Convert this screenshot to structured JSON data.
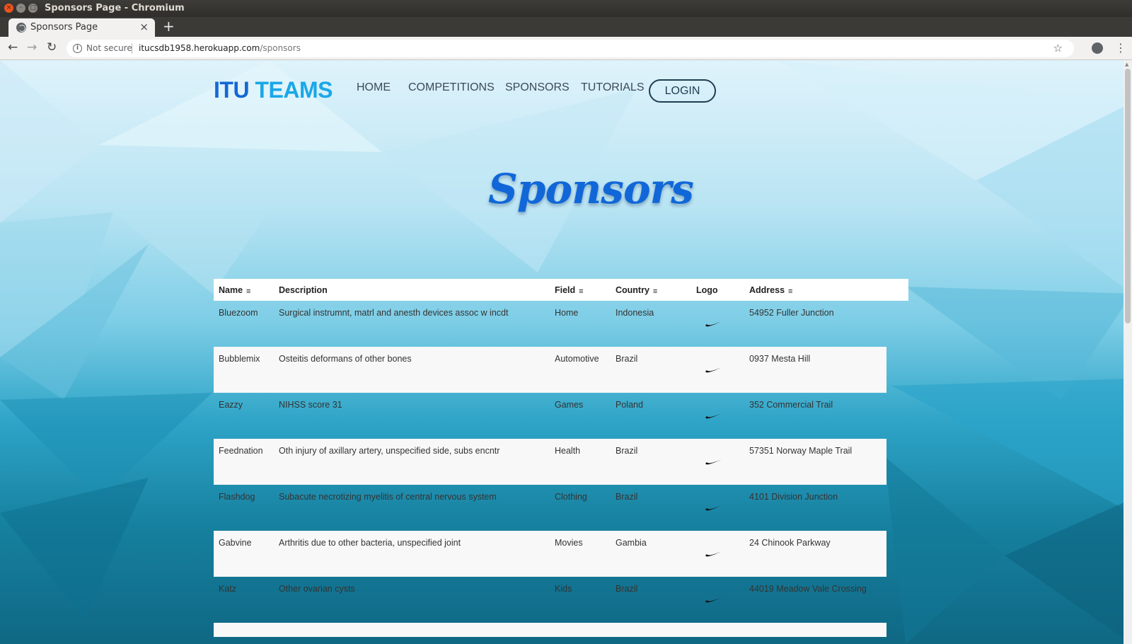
{
  "window": {
    "title": "Sponsors Page - Chromium"
  },
  "tab": {
    "title": "Sponsors Page",
    "close": "×",
    "new_tab": "+"
  },
  "toolbar": {
    "not_secure": "Not secure",
    "url_host": "itucsdb1958.herokuapp.com",
    "url_path": "/sponsors",
    "back": "←",
    "forward": "→",
    "reload": "↻",
    "star": "☆",
    "menu": "⋮"
  },
  "site": {
    "logo_part1": "ITU ",
    "logo_part2": "TEAMS",
    "nav": [
      "HOME",
      "COMPETITIONS",
      "SPONSORS",
      "TUTORIALS"
    ],
    "login": "LOGIN"
  },
  "heading": "Sponsors",
  "table": {
    "headers": {
      "name": "Name",
      "description": "Description",
      "field": "Field",
      "country": "Country",
      "logo": "Logo",
      "address": "Address"
    },
    "sort_icon": "≡",
    "rows": [
      {
        "name": "Bluezoom",
        "description": "Surgical instrumnt, matrl and anesth devices assoc w incdt",
        "field": "Home",
        "country": "Indonesia",
        "address": "54952 Fuller Junction"
      },
      {
        "name": "Bubblemix",
        "description": "Osteitis deformans of other bones",
        "field": "Automotive",
        "country": "Brazil",
        "address": "0937 Mesta Hill"
      },
      {
        "name": "Eazzy",
        "description": "NIHSS score 31",
        "field": "Games",
        "country": "Poland",
        "address": "352 Commercial Trail"
      },
      {
        "name": "Feednation",
        "description": "Oth injury of axillary artery, unspecified side, subs encntr",
        "field": "Health",
        "country": "Brazil",
        "address": "57351 Norway Maple Trail"
      },
      {
        "name": "Flashdog",
        "description": "Subacute necrotizing myelitis of central nervous system",
        "field": "Clothing",
        "country": "Brazil",
        "address": "4101 Division Junction"
      },
      {
        "name": "Gabvine",
        "description": "Arthritis due to other bacteria, unspecified joint",
        "field": "Movies",
        "country": "Gambia",
        "address": "24 Chinook Parkway"
      },
      {
        "name": "Katz",
        "description": "Other ovarian cysts",
        "field": "Kids",
        "country": "Brazil",
        "address": "44019 Meadow Vale Crossing"
      }
    ]
  }
}
